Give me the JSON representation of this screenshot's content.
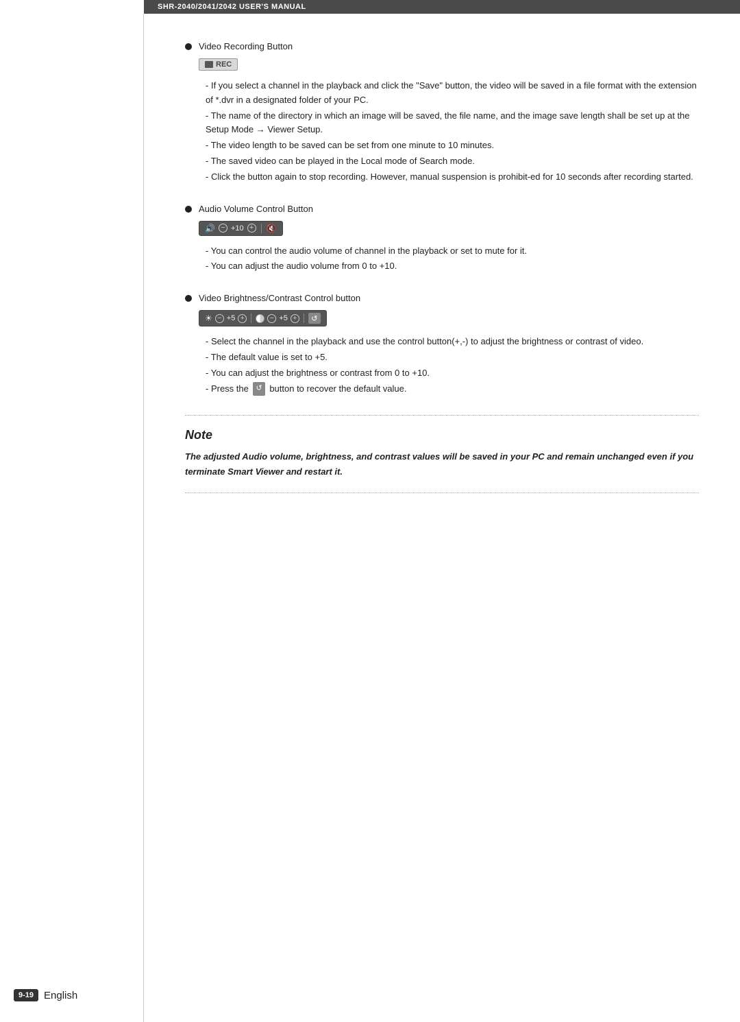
{
  "header": {
    "title": "SHR-2040/2041/2042 USER'S MANUAL"
  },
  "sections": [
    {
      "id": "video-recording",
      "bullet_title": "Video Recording Button",
      "button_label": "REC",
      "descriptions": [
        "If you select a channel in the playback and click the \"Save\" button, the video will be saved in a file format with the extension of *.dvr in a designated folder of your PC.",
        "The name of the directory in which an image will be saved, the file name, and the image save length shall be set up at the Setup Mode → Viewer Setup.",
        "The video length to be saved can be set from one minute to 10 minutes.",
        "The saved video can be played in the Local mode of Search mode.",
        "Click the button again to stop recording. However, manual suspension is prohibit-ed for 10 seconds after recording started."
      ]
    },
    {
      "id": "audio-volume",
      "bullet_title": "Audio Volume Control Button",
      "descriptions": [
        "You can control the audio volume of channel in the playback or set to mute for it.",
        "You can adjust the audio volume from 0 to +10."
      ]
    },
    {
      "id": "brightness-contrast",
      "bullet_title": "Video Brightness/Contrast Control button",
      "descriptions": [
        "Select the channel in the playback and use the control button(+,-) to adjust the brightness or contrast of video.",
        "The default value is set to +5.",
        "You can adjust the brightness or contrast from 0 to +10.",
        "Press the  button to recover the default value."
      ]
    }
  ],
  "note": {
    "title": "Note",
    "text": "The adjusted Audio volume, brightness, and contrast values will be saved in your PC and remain unchanged even if you terminate Smart Viewer and restart it."
  },
  "footer": {
    "badge": "9-19",
    "language": "English"
  },
  "audio_controls": {
    "value": "+10"
  },
  "brightness_controls": {
    "value1": "+5",
    "value2": "+5"
  }
}
